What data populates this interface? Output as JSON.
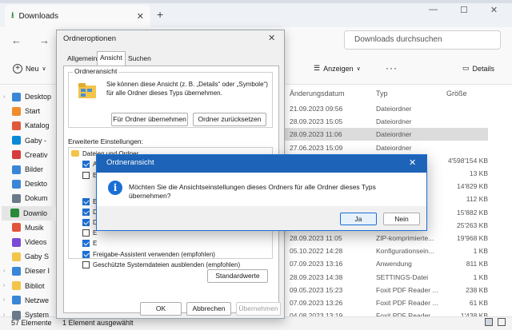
{
  "tab": {
    "title": "Downloads"
  },
  "search": {
    "placeholder": "Downloads durchsuchen"
  },
  "toolbar": {
    "new_label": "Neu",
    "view_label": "Anzeigen",
    "more_label": "···",
    "details_label": "Details"
  },
  "columns": {
    "date": "Änderungsdatum",
    "type": "Typ",
    "size": "Größe"
  },
  "sidebar": {
    "items": [
      "Desktop",
      "Start",
      "Katalog",
      "Gaby -",
      "Creativ",
      "Bilder",
      "Deskto",
      "Dokum",
      "Downlo",
      "Musik",
      "Videos",
      "Gaby S",
      "Dieser I",
      "Bibliot",
      "Netzwe",
      "System"
    ]
  },
  "files": [
    {
      "date": "21.09.2023 09:56",
      "type": "Dateiordner",
      "size": ""
    },
    {
      "date": "28.09.2023 15:05",
      "type": "Dateiordner",
      "size": ""
    },
    {
      "date": "28.09.2023 11:06",
      "type": "Dateiordner",
      "size": ""
    },
    {
      "date": "27.06.2023 15:09",
      "type": "Dateiordner",
      "size": ""
    },
    {
      "date": "",
      "type": "...",
      "size": "4'598'154 KB"
    },
    {
      "date": "",
      "type": "",
      "size": "13 KB"
    },
    {
      "date": "",
      "type": "",
      "size": "14'829 KB"
    },
    {
      "date": "",
      "type": "",
      "size": "112 KB"
    },
    {
      "date": "",
      "type": "",
      "size": "15'882 KB"
    },
    {
      "date": "",
      "type": "",
      "size": "25'263 KB"
    },
    {
      "date": "28.09.2023 11:05",
      "type": "ZIP-komprimierte...",
      "size": "19'968 KB"
    },
    {
      "date": "05.10.2022 14:28",
      "type": "Konfigurationsein...",
      "size": "1 KB"
    },
    {
      "date": "07.09.2023 13:16",
      "type": "Anwendung",
      "size": "811 KB"
    },
    {
      "date": "28.09.2023 14:38",
      "type": "SETTINGS-Datei",
      "size": "1 KB"
    },
    {
      "date": "09.05.2023 15:23",
      "type": "Foxit PDF Reader ...",
      "size": "238 KB"
    },
    {
      "date": "07.09.2023 13:26",
      "type": "Foxit PDF Reader ...",
      "size": "61 KB"
    },
    {
      "date": "04.08.2023 13:19",
      "type": "Foxit PDF Reader ...",
      "size": "1'438 KB"
    }
  ],
  "status": {
    "count": "57 Elemente",
    "selection": "1 Element ausgewählt"
  },
  "folder_options": {
    "title": "Ordneroptionen",
    "tabs": [
      "Allgemein",
      "Ansicht",
      "Suchen"
    ],
    "group_title": "Ordneransicht",
    "group_desc": "Sie können diese Ansicht (z. B. „Details“ oder „Symbole“) für alle Ordner dieses Typs übernehmen.",
    "apply_button": "Für Ordner übernehmen",
    "reset_button": "Ordner zurücksetzen",
    "advanced_label": "Erweiterte Einstellungen:",
    "advanced_folder": "Dateien und Ordner",
    "advanced_items": [
      {
        "label": "A",
        "checked": true
      },
      {
        "label": "E",
        "checked": false
      },
      {
        "label": "E",
        "checked": true
      },
      {
        "label": "D",
        "checked": true
      },
      {
        "label": "D",
        "checked": true
      },
      {
        "label": "E",
        "checked": false
      },
      {
        "label": "E",
        "checked": true
      },
      {
        "label": "Freigabe-Assistent verwenden (empfohlen)",
        "checked": true
      },
      {
        "label": "Geschützte Systemdateien ausblenden (empfohlen)",
        "checked": false
      }
    ],
    "defaults_button": "Standardwerte",
    "ok_button": "OK",
    "cancel_button": "Abbrechen",
    "apply_disabled_button": "Übernehmen"
  },
  "confirm": {
    "title": "Ordneransicht",
    "message": "Möchten Sie die Ansichtseinstellungen dieses Ordners für alle Ordner dieses Typs übernehmen?",
    "yes": "Ja",
    "no": "Nein"
  },
  "colors": {
    "accent": "#1a6fd6",
    "title_blue": "#1d63b7",
    "folder": "#f3c44a"
  }
}
